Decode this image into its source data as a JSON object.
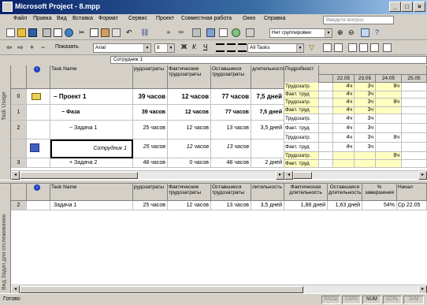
{
  "window": {
    "title": "Microsoft Project - 8.mpp"
  },
  "menu": [
    "Файл",
    "Правка",
    "Вид",
    "Вставка",
    "Формат",
    "Сервис",
    "Проект",
    "Совместная работа",
    "Окно",
    "Справка"
  ],
  "ask_placeholder": "Введите вопрос",
  "toolbar": {
    "group_combo": "Нет группировки",
    "show_label": "Показать",
    "font_combo": "Arial",
    "size_combo": "8",
    "filter_combo": "All Tasks",
    "bold": "Ж",
    "italic": "К",
    "underline": "Ч"
  },
  "entry": {
    "value": "Сотрудник 1"
  },
  "upper": {
    "side_label": "Task Usage",
    "headers": {
      "name": "Task Name",
      "work": "рудозатраты",
      "actual": "Фактические трудозатраты",
      "remaining": "Оставшиеся трудозатраты",
      "duration": "длительность",
      "details": "Подробност"
    },
    "dates": [
      "22.05",
      "23.05",
      "24.05",
      "25.05"
    ],
    "rows": [
      {
        "id": "0",
        "name": "Проект 1",
        "work": "39 часов",
        "actual": "12 часов",
        "remaining": "77 часов",
        "duration": "7,5 дней"
      },
      {
        "id": "1",
        "name": "Фаза",
        "work": "39 часов",
        "actual": "12 часов",
        "remaining": "77 часов",
        "duration": "7,5 дней"
      },
      {
        "id": "2",
        "name": "Задача 1",
        "work": "25 часов",
        "actual": "12 часов",
        "remaining": "13 часов",
        "duration": "3,5 дней"
      },
      {
        "id": "",
        "name": "Сотрудник 1",
        "work": "25 часов",
        "actual": "12 часов",
        "remaining": "13 часов",
        "duration": ""
      },
      {
        "id": "3",
        "name": "Задача 2",
        "work": "48 часов",
        "actual": "0 часов",
        "remaining": "48 часов",
        "duration": "2 дней"
      }
    ],
    "detail_rows": [
      {
        "label": "Трудозатр.",
        "c1": "4ч",
        "c2": "3ч",
        "c3": "8ч"
      },
      {
        "label": "Факт. труд",
        "c1": "4ч",
        "c2": "3ч",
        "c3": ""
      },
      {
        "label": "Трудозатр.",
        "c1": "4ч",
        "c2": "3ч",
        "c3": "8ч"
      },
      {
        "label": "Факт. труд",
        "c1": "4ч",
        "c2": "3ч",
        "c3": ""
      },
      {
        "label": "Трудозатр.",
        "c1": "4ч",
        "c2": "3ч",
        "c3": ""
      },
      {
        "label": "Факт. труд",
        "c1": "4ч",
        "c2": "3ч",
        "c3": ""
      },
      {
        "label": "Трудозатр.",
        "c1": "4ч",
        "c2": "3ч",
        "c3": "8ч"
      },
      {
        "label": "Факт. труд",
        "c1": "4ч",
        "c2": "3ч",
        "c3": ""
      },
      {
        "label": "Трудозатр.",
        "c1": "",
        "c2": "",
        "c3": "8ч"
      },
      {
        "label": "Факт. труд",
        "c1": "",
        "c2": "",
        "c3": ""
      }
    ]
  },
  "lower": {
    "side_label": "Вид Задач для отслеживания",
    "headers": {
      "name": "Task Name",
      "work": "рудозатраты",
      "actual": "Фактические трудозатраты",
      "remaining": "Оставшиеся трудозатраты",
      "duration": "лительность",
      "actual_dur": "Фактическая длительность",
      "rem_dur": "Оставшаяся длительность",
      "pct": "% завершения",
      "start": "Начал"
    },
    "row": {
      "id": "2",
      "name": "Задача 1",
      "work": "25 часов",
      "actual": "12 часов",
      "remaining": "13 часов",
      "duration": "3,5 дней",
      "actual_dur": "1,88 дней",
      "rem_dur": "1,63 дней",
      "pct": "54%",
      "start": "Ср 22.05"
    }
  },
  "status": {
    "text": "Готово",
    "panels": [
      "РАСШ",
      "CAPS",
      "NUM",
      "SCRL",
      "ЗАМ"
    ]
  }
}
